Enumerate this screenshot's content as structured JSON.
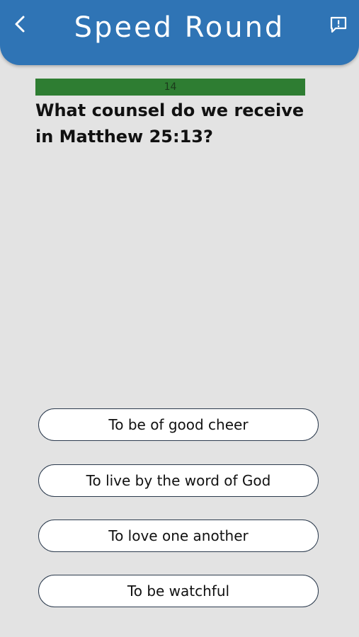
{
  "header": {
    "title": "Speed Round",
    "back_icon": "chevron-left-icon",
    "report_icon": "report-feedback-icon",
    "color": "#2f74b5"
  },
  "timer": {
    "value": "14",
    "fill_fraction": 1.0,
    "color": "#2e7d32"
  },
  "question": {
    "text": "What counsel do we receive in Matthew 25:13?"
  },
  "answers": [
    {
      "label": "To be of good cheer"
    },
    {
      "label": "To live by the word of God"
    },
    {
      "label": "To love one another"
    },
    {
      "label": "To be watchful"
    }
  ]
}
